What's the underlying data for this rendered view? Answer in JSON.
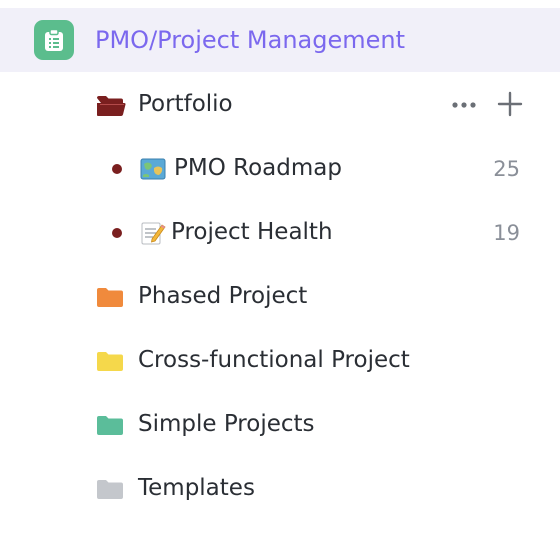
{
  "space": {
    "title": "PMO/Project Management",
    "icon": "clipboard-icon",
    "icon_color": "#5bbd8d",
    "title_color": "#7b68ee",
    "highlight_color": "#f1f0f9"
  },
  "folders": [
    {
      "label": "Portfolio",
      "color": "#7a1f1f",
      "icon": "folder-open-icon",
      "expanded": true,
      "actions": {
        "more": "more-icon",
        "add": "plus-icon"
      },
      "lists": [
        {
          "emoji": "map-emoji",
          "label": "PMO Roadmap",
          "count": "25"
        },
        {
          "emoji": "memo-emoji",
          "label": "Project Health",
          "count": "19"
        }
      ]
    },
    {
      "label": "Phased Project",
      "color": "#f08a3c",
      "icon": "folder-icon"
    },
    {
      "label": "Cross-functional Project",
      "color": "#f5d84b",
      "icon": "folder-icon"
    },
    {
      "label": "Simple Projects",
      "color": "#5bbd9a",
      "icon": "folder-icon"
    },
    {
      "label": "Templates",
      "color": "#c4c7cc",
      "icon": "folder-icon"
    }
  ]
}
